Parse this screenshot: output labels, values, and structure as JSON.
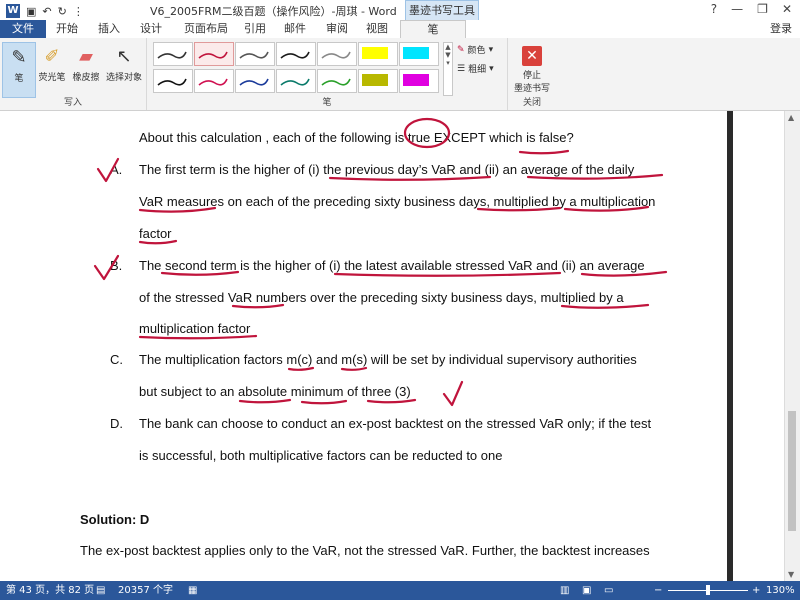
{
  "window": {
    "title": "V6_2005FRM二级百题（操作风险）-周琪 - Word",
    "ink_tools_tab": "墨迹书写工具",
    "help": "?",
    "minimize": "—",
    "restore": "❐",
    "close": "✕"
  },
  "tabs": [
    "文件",
    "开始",
    "插入",
    "设计",
    "页面布局",
    "引用",
    "邮件",
    "审阅",
    "视图",
    "笔"
  ],
  "active_tab": "笔",
  "login": "登录",
  "ribbon": {
    "write_group": {
      "label": "写入",
      "buttons": [
        "笔",
        "荧光笔",
        "橡皮擦",
        "选择对象"
      ]
    },
    "pens_group": {
      "label": "笔",
      "color_label": "颜色",
      "thickness_label": "粗细"
    },
    "close_group": {
      "label": "关闭",
      "stop_line1": "停止",
      "stop_line2": "墨迹书写"
    }
  },
  "document": {
    "intro": "About this calculation , each of the following is true EXCEPT which is false?",
    "options": [
      {
        "letter": "A.",
        "lines": [
          "The first term is the higher of (i) the previous day’s VaR and (ii) an average of the daily",
          "VaR measures on each of the preceding sixty business days, multiplied by a multiplication",
          "factor"
        ]
      },
      {
        "letter": "B.",
        "lines": [
          "The second term is the higher of (i) the latest available stressed VaR and (ii) an average",
          "of the stressed VaR numbers over the preceding sixty business days, multiplied by a",
          "multiplication factor"
        ]
      },
      {
        "letter": "C.",
        "lines": [
          "The multiplication factors m(c) and m(s) will be set by individual supervisory authorities",
          "but subject to an absolute minimum of three (3)"
        ]
      },
      {
        "letter": "D.",
        "lines": [
          "The bank can choose to conduct an ex-post backtest on the stressed VaR only; if the test",
          "is successful, both multiplicative factors can be reducted to one"
        ]
      }
    ],
    "solution_label": "Solution: D",
    "solution_text": "The ex-post backtest applies only to the VaR, not the stressed VaR. Further, the backtest increases"
  },
  "status": {
    "page": "第 43 页，共 82 页",
    "words": "20357 个字",
    "zoom": "130%",
    "zoom_minus": "−",
    "zoom_plus": "+"
  },
  "pen_colors": [
    "#333333",
    "#c0143c",
    "#555555",
    "#1a1a1a",
    "#888888",
    "#ffff00",
    "#00e5ff",
    "#111111",
    "#d01050",
    "#1a3a9a",
    "#0a7a6a",
    "#2aa02a",
    "#b8b800",
    "#e000e0"
  ],
  "ink_color": "#c0143c"
}
